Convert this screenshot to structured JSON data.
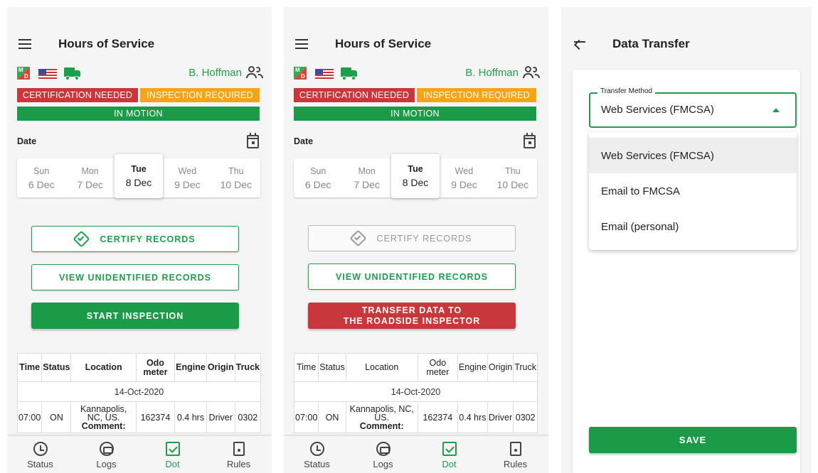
{
  "colors": {
    "green": "#1e9e4a",
    "red": "#c8383a",
    "orange": "#f3a419"
  },
  "screen1": {
    "title": "Hours of Service",
    "md_letters": [
      "M",
      "D"
    ],
    "driver": "B. Hoffman",
    "badge_cert": "CERTIFICATION NEEDED",
    "badge_insp": "INSPECTION REQUIRED",
    "motion": "IN MOTION",
    "date_label": "Date",
    "days": [
      {
        "dow": "Sun",
        "date": "6 Dec"
      },
      {
        "dow": "Mon",
        "date": "7 Dec"
      },
      {
        "dow": "Tue",
        "date": "8 Dec"
      },
      {
        "dow": "Wed",
        "date": "9 Dec"
      },
      {
        "dow": "Thu",
        "date": "10 Dec"
      }
    ],
    "btn_certify": "CERTIFY RECORDS",
    "btn_unidentified": "VIEW UNIDENTIFIED RECORDS",
    "btn_inspection": "START INSPECTION",
    "table": {
      "headers": [
        "Time",
        "Status",
        "Location",
        "Odo meter",
        "Engine",
        "Origin",
        "Truck"
      ],
      "date": "14-Oct-2020",
      "row": {
        "time": "07:00",
        "status": "ON",
        "location": "Kannapolis, NC, US.",
        "comment": "Comment:",
        "odometer": "162374",
        "engine": "0.4 hrs",
        "origin": "Driver",
        "truck": "0302"
      }
    },
    "nav": [
      "Status",
      "Logs",
      "Dot",
      "Rules"
    ]
  },
  "screen2": {
    "title": "Hours of Service",
    "md_letters": [
      "M",
      "D"
    ],
    "driver": "B. Hoffman",
    "badge_cert": "CERTIFICATION NEEDED",
    "badge_insp": "INSPECTION REQUIRED",
    "motion": "IN MOTION",
    "date_label": "Date",
    "days": [
      {
        "dow": "Sun",
        "date": "6 Dec"
      },
      {
        "dow": "Mon",
        "date": "7 Dec"
      },
      {
        "dow": "Tue",
        "date": "8 Dec"
      },
      {
        "dow": "Wed",
        "date": "9 Dec"
      },
      {
        "dow": "Thu",
        "date": "10 Dec"
      }
    ],
    "btn_certify": "CERTIFY RECORDS",
    "btn_unidentified": "VIEW UNIDENTIFIED RECORDS",
    "btn_transfer_line1": "TRANSFER DATA TO",
    "btn_transfer_line2": "THE ROADSIDE INSPECTOR",
    "table": {
      "headers": [
        "Time",
        "Status",
        "Location",
        "Odo meter",
        "Engine",
        "Origin",
        "Truck"
      ],
      "date": "14-Oct-2020",
      "row": {
        "time": "07:00",
        "status": "ON",
        "location": "Kannapolis, NC, US.",
        "comment": "Comment:",
        "odometer": "162374",
        "engine": "0.4 hrs",
        "origin": "Driver",
        "truck": "0302"
      }
    },
    "nav": [
      "Status",
      "Logs",
      "Dot",
      "Rules"
    ]
  },
  "screen3": {
    "title": "Data Transfer",
    "field_label": "Transfer Method",
    "field_value": "Web Services (FMCSA)",
    "options": [
      "Web Services (FMCSA)",
      "Email to FMCSA",
      "Email (personal)"
    ],
    "save": "SAVE"
  }
}
